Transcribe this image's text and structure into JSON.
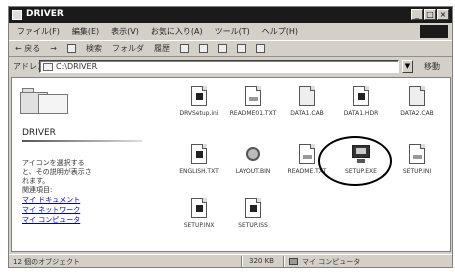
{
  "window": {
    "title": "DRIVER",
    "controls": [
      "_",
      "□",
      "×"
    ]
  },
  "menubar": [
    "ファイル(F)",
    "編集(E)",
    "表示(V)",
    "お気に入り(A)",
    "ツール(T)",
    "ヘルプ(H)"
  ],
  "toolbar": {
    "back": "← 戻る",
    "forward": "→",
    "search": "検索",
    "folders": "フォルダ",
    "history": "履歴"
  },
  "address": {
    "label": "アドレス(D)",
    "value": "C:\\DRIVER",
    "go": "移動"
  },
  "leftpane": {
    "folder_title": "DRIVER",
    "description": "アイコンを選択すると、その説明が表示されます。",
    "see_also": "関連項目:",
    "links": [
      "マイ ドキュメント",
      "マイ ネットワーク",
      "マイ コンピュータ"
    ]
  },
  "files": [
    {
      "label": "DRVSetup.ini",
      "icon": "gear-document"
    },
    {
      "label": "README01.TXT",
      "icon": "setup-document"
    },
    {
      "label": "DATA1.CAB",
      "icon": "cab-document"
    },
    {
      "label": "DATA1.HDR",
      "icon": "cab-document"
    },
    {
      "label": "DATA2.CAB",
      "icon": "cab-document"
    },
    {
      "label": "ENGLISH.TXT",
      "icon": "gear-document"
    },
    {
      "label": "LAYOUT.BIN",
      "icon": "setup-wizard"
    },
    {
      "label": "README.TXT",
      "icon": "text-document"
    },
    {
      "label": "SETUP.EXE",
      "icon": "setup-monitor"
    },
    {
      "label": "SETUP.INI",
      "icon": "text-document"
    },
    {
      "label": "SETUP.INX",
      "icon": "setup-document"
    },
    {
      "label": "SETUP.ISS",
      "icon": "setup-document"
    }
  ],
  "statusbar": {
    "objects": "12 個のオブジェクト",
    "size": "320 KB",
    "location": "マイ コンピュータ"
  }
}
